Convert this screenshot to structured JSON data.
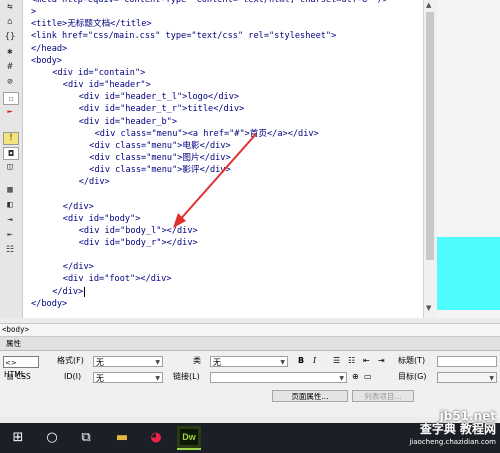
{
  "left_toolbar": {
    "icons": [
      {
        "name": "collapse-icon",
        "glyph": "⇆"
      },
      {
        "name": "select-parent-tag-icon",
        "glyph": "⌂"
      },
      {
        "name": "balance-braces-icon",
        "glyph": "{}"
      },
      {
        "name": "expand-all-icon",
        "glyph": "✱"
      },
      {
        "name": "line-numbers-icon",
        "glyph": "#"
      },
      {
        "name": "highlight-invalid-icon",
        "glyph": "⊘"
      },
      {
        "name": "syntax-error-icon",
        "glyph": "☐"
      },
      {
        "name": "word-wrap-icon",
        "glyph": "⇤"
      },
      {
        "name": "info-bar-icon",
        "glyph": "!"
      },
      {
        "name": "apply-comment-icon",
        "glyph": "◘"
      },
      {
        "name": "remove-comment-icon",
        "glyph": "◫"
      },
      {
        "name": "recent-snippet-icon",
        "glyph": "▦"
      },
      {
        "name": "move-css-icon",
        "glyph": "◧"
      },
      {
        "name": "indent-icon",
        "glyph": "⇥"
      },
      {
        "name": "outdent-icon",
        "glyph": "⇤"
      },
      {
        "name": "format-source-icon",
        "glyph": "☷"
      }
    ]
  },
  "code": {
    "lines": [
      {
        "text": "<meta http-equiv=\"Content-Type\" content=\"text/html; charset=utf-8\" />",
        "indent": 0
      },
      {
        "text": ">",
        "indent": 0
      },
      {
        "text": "<title>无标题文档</title>",
        "indent": 0
      },
      {
        "text": "<link href=\"css/main.css\" type=\"text/css\" rel=\"stylesheet\">",
        "indent": 0
      },
      {
        "text": "</head>",
        "indent": 0
      },
      {
        "text": "<body>",
        "indent": 0
      },
      {
        "text": "<div id=\"contain\">",
        "indent": 4
      },
      {
        "text": "<div id=\"header\">",
        "indent": 6
      },
      {
        "text": "<div id=\"header_t_l\">logo</div>",
        "indent": 9
      },
      {
        "text": "<div id=\"header_t_r\">title</div>",
        "indent": 9
      },
      {
        "text": "<div id=\"header_b\">",
        "indent": 9
      },
      {
        "text": "<div class=\"menu\"><a href=\"#\">首页</a></div>",
        "indent": 12
      },
      {
        "text": "<div class=\"menu\">电影</div>",
        "indent": 11
      },
      {
        "text": "<div class=\"menu\">图片</div>",
        "indent": 11
      },
      {
        "text": "<div class=\"menu\">影评</div>",
        "indent": 11
      },
      {
        "text": "</div>",
        "indent": 9
      },
      {
        "text": "",
        "indent": 0
      },
      {
        "text": "</div>",
        "indent": 6
      },
      {
        "text": "<div id=\"body\">",
        "indent": 6
      },
      {
        "text": "<div id=\"body_l\"></div>",
        "indent": 9
      },
      {
        "text": "<div id=\"body_r\"></div>",
        "indent": 9
      },
      {
        "text": "",
        "indent": 0
      },
      {
        "text": "</div>",
        "indent": 6
      },
      {
        "text": "<div id=\"foot\"></div>",
        "indent": 6
      },
      {
        "text": "</div>",
        "indent": 4
      },
      {
        "text": "</body>",
        "indent": 0
      }
    ]
  },
  "tag_selector": {
    "text": "<body>"
  },
  "properties": {
    "header_label": "属性",
    "html_tab": "HTML",
    "css_tab": "CSS",
    "format_label": "格式(F)",
    "format_value": "无",
    "class_label": "类",
    "class_value": "无",
    "id_label": "ID(I)",
    "id_value": "无",
    "link_label": "链接(L)",
    "link_value": "",
    "bold": "B",
    "italic": "I",
    "title_label": "标题(T)",
    "target_label": "目标(G)",
    "page_props_button": "页面属性...",
    "list_item_button": "列表项目..."
  },
  "taskbar": {
    "start": "⊞",
    "search": "○",
    "taskview": "⧉",
    "explorer": "▬",
    "chrome": "◕",
    "dw_label": "Dw"
  },
  "watermark": {
    "main": "jb51.net",
    "line2": "查字典 教程网",
    "small": "jiaocheng.chazidian.com"
  },
  "colors": {
    "tag": "#000080",
    "attr_value": "#0000ff",
    "design_cyan": "#4dfcfc",
    "arrow": "#e03030"
  }
}
